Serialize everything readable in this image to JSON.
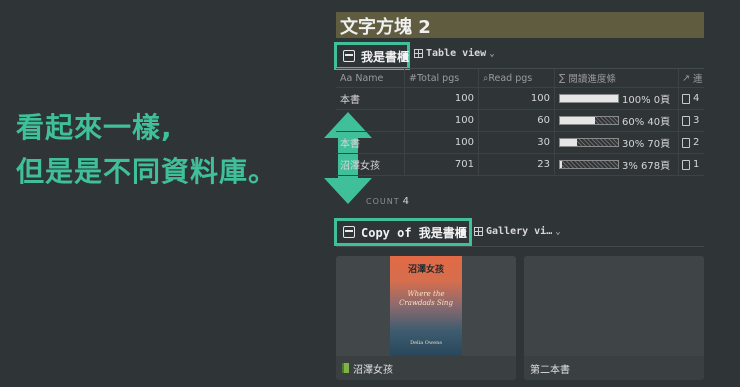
{
  "annotation": {
    "line1": "看起來一樣,",
    "line2": "但是是不同資料庫。"
  },
  "page_title": "文字方塊 2",
  "database1": {
    "title": "我是書櫃",
    "view_label": "Table view",
    "columns": [
      "Name",
      "Total pgs",
      "Read pgs",
      "閱讀進度條",
      "連"
    ],
    "rows": [
      {
        "name": "本書",
        "total": "100",
        "read": "100",
        "progress": 1.0,
        "progress_text": "100% 0頁",
        "rel": "4"
      },
      {
        "name": "",
        "total": "100",
        "read": "60",
        "progress": 0.6,
        "progress_text": "60% 40頁",
        "rel": "3"
      },
      {
        "name": "本書",
        "total": "100",
        "read": "30",
        "progress": 0.3,
        "progress_text": "30% 70頁",
        "rel": "2"
      },
      {
        "name": "沼澤女孩",
        "total": "701",
        "read": "23",
        "progress": 0.03,
        "progress_text": "3% 678頁",
        "rel": "1"
      }
    ],
    "count_label": "COUNT",
    "count_value": "4"
  },
  "database2": {
    "title": "Copy of 我是書櫃",
    "view_label": "Gallery vi…",
    "cards": [
      {
        "caption": "沼澤女孩",
        "cover_title": "沼澤女孩",
        "cover_en": "Where the Crawdads Sing",
        "cover_author": "Delia Owens"
      },
      {
        "caption": "第二本書"
      }
    ]
  },
  "colors": {
    "accent": "#3fbf9a",
    "title_bg": "#605c3f",
    "background": "#2f3437"
  }
}
